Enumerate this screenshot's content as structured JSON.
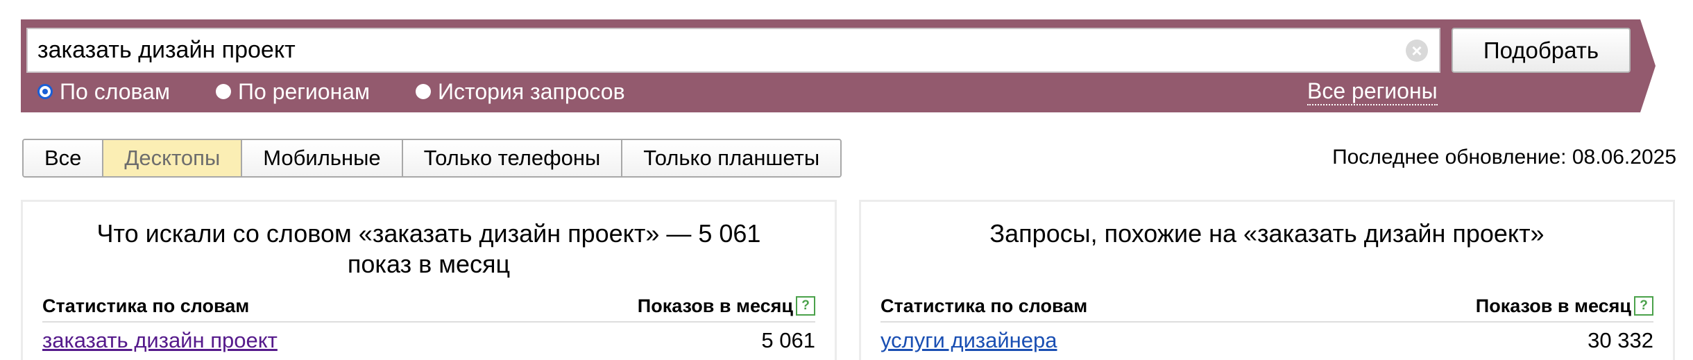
{
  "search": {
    "query": "заказать дизайн проект",
    "submit_label": "Подобрать",
    "modes": [
      {
        "label": "По словам",
        "checked": true
      },
      {
        "label": "По регионам",
        "checked": false
      },
      {
        "label": "История запросов",
        "checked": false
      }
    ],
    "regions_link": "Все регионы"
  },
  "device_tabs": [
    {
      "label": "Все",
      "active": false
    },
    {
      "label": "Десктопы",
      "active": true
    },
    {
      "label": "Мобильные",
      "active": false
    },
    {
      "label": "Только телефоны",
      "active": false
    },
    {
      "label": "Только планшеты",
      "active": false
    }
  ],
  "last_update": "Последнее обновление: 08.06.2025",
  "left_panel": {
    "title": "Что искали со словом «заказать дизайн проект» — 5 061 показ в месяц",
    "col_words": "Статистика по словам",
    "col_shows": "Показов в месяц",
    "help_icon": "?",
    "rows": [
      {
        "phrase": "заказать дизайн проект",
        "count": "5 061"
      }
    ]
  },
  "right_panel": {
    "title": "Запросы, похожие на «заказать дизайн проект»",
    "col_words": "Статистика по словам",
    "col_shows": "Показов в месяц",
    "help_icon": "?",
    "rows": [
      {
        "phrase": "услуги дизайнера",
        "count": "30 332"
      }
    ]
  },
  "icons": {
    "clear": "clear-icon",
    "help": "help-icon"
  },
  "colors": {
    "band": "#935a6e",
    "active_tab": "#fbeeb4",
    "visited_link": "#551a8b",
    "link": "#1a4fb3",
    "help": "#4aa14a"
  }
}
